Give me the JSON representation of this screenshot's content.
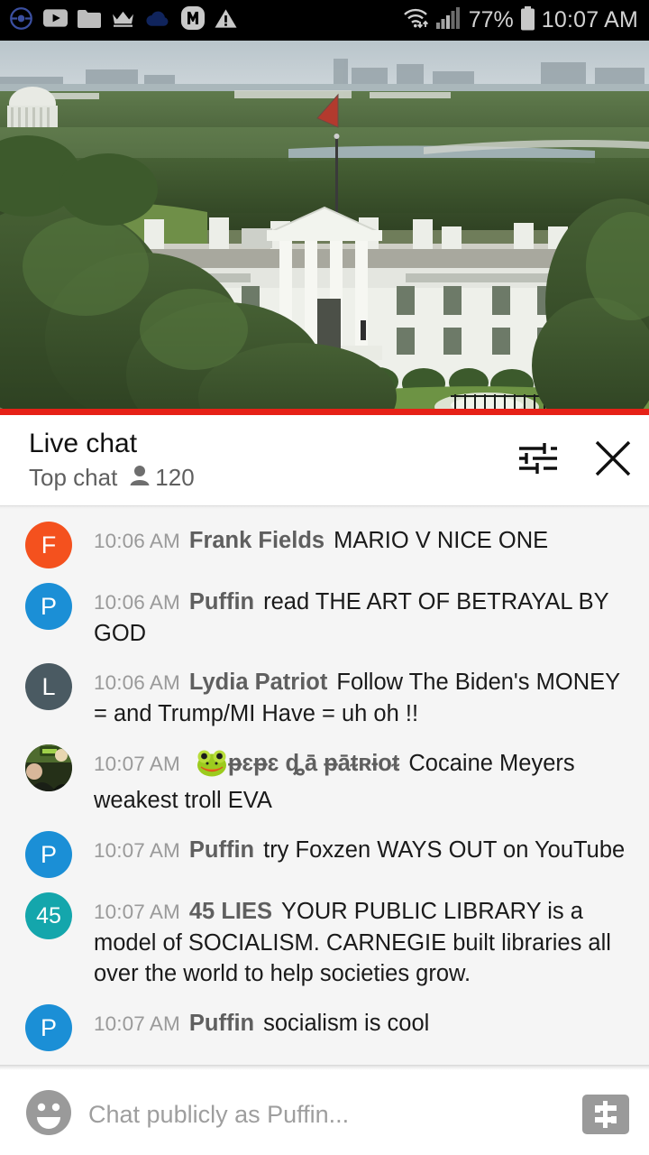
{
  "status_bar": {
    "left_icons": [
      {
        "name": "pokeball-icon",
        "label": "Pokemon GO"
      },
      {
        "name": "youtube-icon",
        "label": "YouTube"
      },
      {
        "name": "folder-icon",
        "label": "Folder"
      },
      {
        "name": "crown-icon",
        "label": "Crown"
      },
      {
        "name": "cloud-icon",
        "label": "Cloud"
      },
      {
        "name": "m-badge-icon",
        "label": "M"
      },
      {
        "name": "warning-triangle-icon",
        "label": "Warning"
      }
    ],
    "wifi": "wifi-icon",
    "signal": "cell-signal-icon",
    "battery_percent": "77%",
    "battery_icon": "battery-icon",
    "time": "10:07 AM"
  },
  "video": {
    "title": "White House live stream",
    "progress_percent": 100,
    "progress_color": "#e62117"
  },
  "chat_header": {
    "title": "Live chat",
    "subtitle": "Top chat",
    "viewer_count": "120",
    "viewer_icon": "person-icon",
    "settings_icon": "tune-sliders-icon",
    "close_icon": "close-icon"
  },
  "messages": [
    {
      "timestamp": "10:06 AM",
      "author": "Frank Fields",
      "text": "MARIO V NICE ONE",
      "avatar_letter": "F",
      "avatar_color": "#f4511e",
      "avatar_type": "letter"
    },
    {
      "timestamp": "10:06 AM",
      "author": "Puffin",
      "text": "read THE ART OF BETRAYAL BY GOD",
      "avatar_letter": "P",
      "avatar_color": "#1b8fd6",
      "avatar_type": "letter"
    },
    {
      "timestamp": "10:06 AM",
      "author": "Lydia Patriot",
      "text": "Follow The Biden's MONEY = and Trump/MI Have = uh oh !!",
      "avatar_letter": "L",
      "avatar_color": "#4a5a62",
      "avatar_type": "letter"
    },
    {
      "timestamp": "10:07 AM",
      "author": "ᵽɛᵽɛ ȡā̄ ᵽā̄ᵵʀɨoᵵ",
      "text": "Cocaine Meyers weakest troll EVA",
      "avatar_letter": "",
      "avatar_color": "#2e3f2a",
      "avatar_type": "photo",
      "author_emoji": "frog-emoji"
    },
    {
      "timestamp": "10:07 AM",
      "author": "Puffin",
      "text": "try Foxzen WAYS OUT on YouTube",
      "avatar_letter": "P",
      "avatar_color": "#1b8fd6",
      "avatar_type": "letter"
    },
    {
      "timestamp": "10:07 AM",
      "author": "45 LIES",
      "text": "YOUR PUBLIC LIBRARY is a model of SOCIALISM. CARNEGIE built libraries all over the world to help societies grow.",
      "avatar_letter": "45",
      "avatar_color": "#14a6ac",
      "avatar_type": "number"
    },
    {
      "timestamp": "10:07 AM",
      "author": "Puffin",
      "text": "socialism is cool",
      "avatar_letter": "P",
      "avatar_color": "#1b8fd6",
      "avatar_type": "letter"
    }
  ],
  "composer": {
    "emoji_icon": "emoji-smiley-icon",
    "placeholder": "Chat publicly as Puffin...",
    "value": "",
    "money_icon": "super-chat-dollar-icon"
  }
}
